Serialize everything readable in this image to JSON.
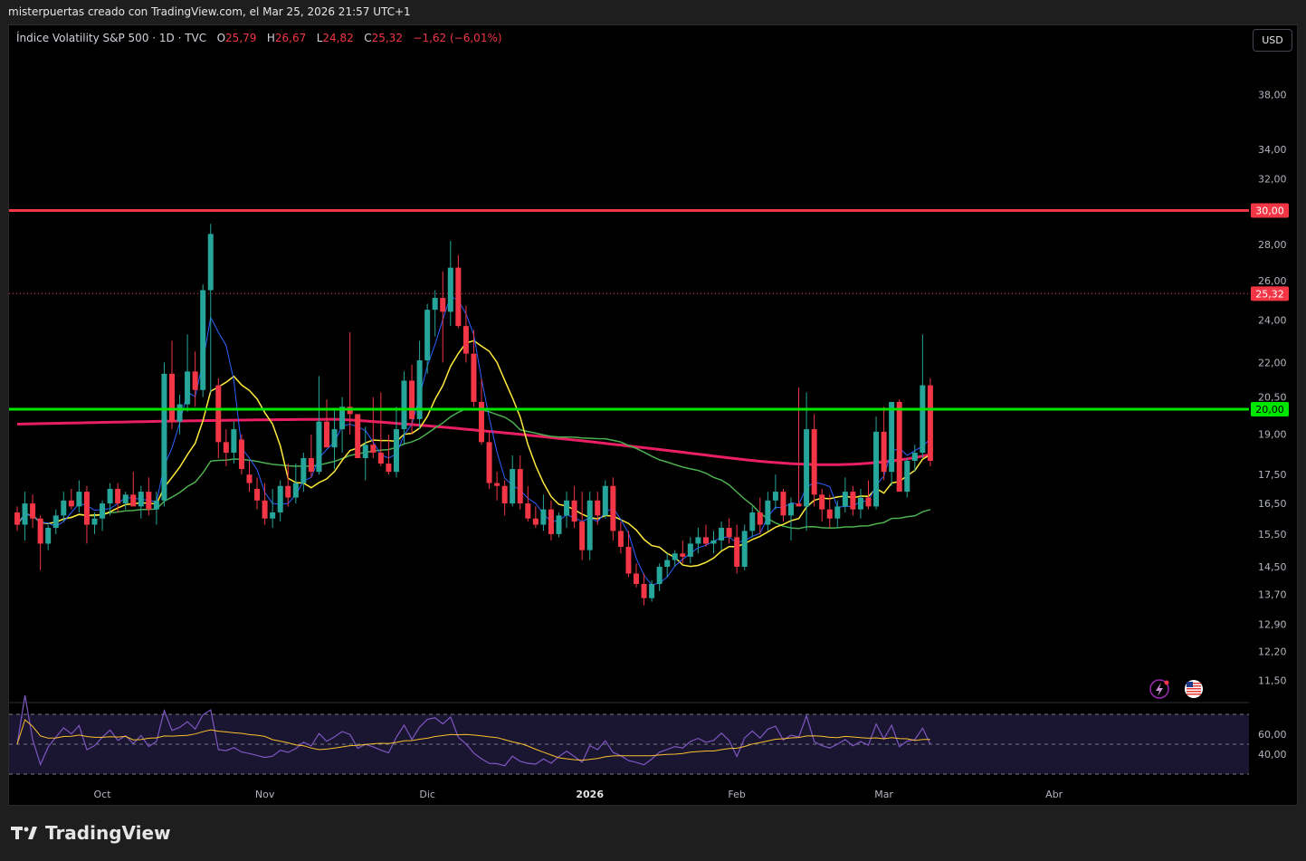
{
  "header": {
    "text": "misterpuertas creado con TradingView.com, el Mar 25, 2026 21:57 UTC+1"
  },
  "legend": {
    "symbol": "Índice Volatility S&P 500 · 1D · TVC",
    "open_label": "O",
    "open": "25,79",
    "high_label": "H",
    "high": "26,67",
    "low_label": "L",
    "low": "24,82",
    "close_label": "C",
    "close": "25,32",
    "change": "−1,62 (−6,01%)"
  },
  "currency_button": "USD",
  "brand": "TradingView",
  "colors": {
    "up": "#26a69a",
    "down": "#f23645",
    "resistance": "#f23645",
    "support": "#00e600",
    "ma_fast": "#2962ff",
    "ma_mid": "#ffeb3b",
    "ma_slow": "#4caf50",
    "ma_long": "#e91e63",
    "rsi": "#7e57c2"
  },
  "icons": {
    "lightning": "lightning-icon",
    "flag": "us-flag-icon"
  },
  "chart_data": {
    "type": "candlestick",
    "y_scale": "log",
    "y_ticks": [
      "38,00",
      "34,00",
      "32,00",
      "30,00",
      "28,00",
      "26,00",
      "24,00",
      "22,00",
      "20,50",
      "19,00",
      "17,50",
      "16,50",
      "15,50",
      "14,50",
      "13,70",
      "12,90",
      "12,20",
      "11,50"
    ],
    "x_ticks": [
      {
        "label": "Oct",
        "bold": false,
        "i": 11
      },
      {
        "label": "Nov",
        "bold": false,
        "i": 32
      },
      {
        "label": "Dic",
        "bold": false,
        "i": 53
      },
      {
        "label": "2026",
        "bold": true,
        "i": 74
      },
      {
        "label": "Feb",
        "bold": false,
        "i": 93
      },
      {
        "label": "Mar",
        "bold": false,
        "i": 112
      },
      {
        "label": "Abr",
        "bold": false,
        "i": 134
      }
    ],
    "horizontal_levels": [
      {
        "value": 30.0,
        "label": "30,00",
        "color": "#f23645"
      },
      {
        "value": 20.0,
        "label": "20,00",
        "color": "#00e600"
      }
    ],
    "last_price": {
      "value": 25.32,
      "label": "25,32"
    },
    "candles": [
      [
        16.2,
        16.4,
        15.6,
        15.8
      ],
      [
        15.8,
        16.9,
        15.3,
        16.5
      ],
      [
        16.5,
        16.8,
        15.7,
        16.0
      ],
      [
        16.0,
        16.1,
        14.4,
        15.2
      ],
      [
        15.2,
        15.8,
        15.0,
        15.7
      ],
      [
        15.7,
        16.3,
        15.5,
        16.1
      ],
      [
        16.1,
        16.9,
        15.9,
        16.6
      ],
      [
        16.6,
        17.0,
        16.3,
        16.4
      ],
      [
        16.4,
        17.3,
        16.2,
        16.9
      ],
      [
        16.9,
        17.1,
        15.2,
        15.8
      ],
      [
        15.8,
        16.2,
        15.5,
        16.0
      ],
      [
        16.0,
        16.6,
        15.6,
        16.5
      ],
      [
        16.5,
        17.2,
        16.1,
        17.0
      ],
      [
        17.0,
        17.2,
        16.2,
        16.5
      ],
      [
        16.5,
        16.9,
        16.3,
        16.8
      ],
      [
        16.8,
        17.6,
        16.5,
        16.4
      ],
      [
        16.4,
        17.1,
        16.0,
        16.9
      ],
      [
        16.9,
        17.4,
        16.1,
        16.3
      ],
      [
        16.3,
        16.9,
        15.8,
        16.6
      ],
      [
        16.6,
        22.0,
        16.4,
        21.5
      ],
      [
        21.5,
        23.0,
        19.2,
        19.5
      ],
      [
        19.5,
        20.6,
        19.0,
        20.2
      ],
      [
        20.2,
        23.3,
        19.9,
        21.6
      ],
      [
        21.6,
        22.5,
        20.1,
        20.8
      ],
      [
        20.8,
        25.8,
        20.5,
        25.5
      ],
      [
        25.5,
        29.2,
        20.7,
        28.6
      ],
      [
        21.0,
        21.3,
        18.1,
        18.7
      ],
      [
        18.7,
        19.2,
        17.8,
        18.3
      ],
      [
        18.3,
        19.5,
        17.9,
        19.2
      ],
      [
        18.8,
        19.0,
        17.5,
        17.7
      ],
      [
        17.5,
        18.0,
        16.9,
        17.2
      ],
      [
        17.0,
        17.4,
        16.3,
        16.6
      ],
      [
        16.6,
        17.2,
        15.8,
        16.0
      ],
      [
        16.0,
        17.0,
        15.7,
        16.2
      ],
      [
        16.2,
        17.3,
        15.9,
        17.1
      ],
      [
        17.1,
        17.9,
        16.4,
        16.7
      ],
      [
        16.7,
        17.9,
        16.5,
        17.2
      ],
      [
        17.2,
        18.3,
        16.9,
        18.1
      ],
      [
        18.1,
        19.0,
        17.4,
        17.6
      ],
      [
        17.6,
        21.4,
        17.5,
        19.5
      ],
      [
        19.5,
        20.4,
        18.6,
        18.5
      ],
      [
        18.5,
        20.0,
        17.7,
        19.2
      ],
      [
        19.2,
        20.5,
        18.3,
        20.1
      ],
      [
        20.1,
        23.4,
        19.0,
        19.8
      ],
      [
        19.8,
        19.8,
        18.5,
        18.1
      ],
      [
        18.1,
        19.3,
        17.3,
        18.6
      ],
      [
        18.6,
        20.5,
        18.1,
        18.3
      ],
      [
        18.3,
        20.7,
        17.8,
        17.9
      ],
      [
        17.9,
        19.0,
        17.5,
        17.6
      ],
      [
        17.6,
        20.1,
        17.4,
        19.2
      ],
      [
        19.2,
        21.6,
        18.6,
        21.2
      ],
      [
        21.2,
        21.9,
        19.0,
        19.6
      ],
      [
        19.6,
        23.0,
        19.2,
        22.1
      ],
      [
        22.1,
        24.8,
        21.5,
        24.5
      ],
      [
        24.5,
        25.5,
        23.2,
        25.1
      ],
      [
        25.1,
        26.5,
        22.0,
        24.4
      ],
      [
        24.4,
        28.2,
        23.7,
        26.7
      ],
      [
        26.7,
        27.4,
        23.6,
        23.7
      ],
      [
        23.7,
        24.7,
        22.0,
        22.4
      ],
      [
        22.4,
        23.5,
        20.1,
        20.3
      ],
      [
        20.3,
        21.3,
        18.6,
        18.7
      ],
      [
        18.7,
        19.1,
        17.0,
        17.2
      ],
      [
        17.2,
        17.6,
        16.6,
        17.1
      ],
      [
        17.1,
        17.3,
        16.1,
        16.5
      ],
      [
        16.5,
        18.2,
        16.4,
        17.7
      ],
      [
        17.7,
        18.2,
        16.3,
        16.5
      ],
      [
        16.5,
        17.1,
        15.9,
        16.0
      ],
      [
        16.0,
        16.4,
        15.7,
        15.8
      ],
      [
        15.8,
        16.8,
        15.6,
        16.3
      ],
      [
        16.3,
        16.6,
        15.3,
        15.5
      ],
      [
        15.5,
        16.2,
        15.4,
        16.1
      ],
      [
        16.1,
        16.9,
        15.7,
        16.6
      ],
      [
        16.6,
        17.1,
        15.7,
        15.9
      ],
      [
        15.9,
        16.9,
        14.7,
        15.0
      ],
      [
        15.0,
        16.9,
        14.7,
        16.6
      ],
      [
        16.6,
        16.9,
        15.8,
        16.1
      ],
      [
        16.1,
        17.3,
        16.0,
        17.1
      ],
      [
        17.1,
        17.4,
        15.3,
        15.6
      ],
      [
        15.6,
        15.9,
        14.9,
        15.1
      ],
      [
        15.1,
        15.6,
        14.2,
        14.3
      ],
      [
        14.3,
        14.6,
        13.9,
        14.0
      ],
      [
        14.0,
        14.3,
        13.4,
        13.6
      ],
      [
        13.6,
        14.1,
        13.5,
        14.0
      ],
      [
        14.0,
        14.6,
        13.8,
        14.5
      ],
      [
        14.5,
        14.9,
        14.2,
        14.7
      ],
      [
        14.7,
        15.0,
        14.5,
        14.9
      ],
      [
        14.9,
        15.3,
        14.6,
        14.8
      ],
      [
        14.8,
        15.4,
        14.6,
        15.2
      ],
      [
        15.2,
        15.7,
        14.9,
        15.4
      ],
      [
        15.4,
        15.8,
        15.1,
        15.2
      ],
      [
        15.2,
        15.6,
        14.9,
        15.3
      ],
      [
        15.3,
        15.9,
        15.0,
        15.7
      ],
      [
        15.7,
        16.0,
        15.2,
        15.4
      ],
      [
        15.4,
        15.8,
        14.3,
        14.5
      ],
      [
        14.5,
        15.8,
        14.4,
        15.6
      ],
      [
        15.6,
        16.4,
        15.4,
        16.2
      ],
      [
        16.2,
        16.7,
        15.5,
        15.8
      ],
      [
        15.8,
        16.9,
        15.6,
        16.6
      ],
      [
        16.6,
        17.5,
        16.3,
        16.9
      ],
      [
        16.9,
        17.0,
        15.9,
        16.1
      ],
      [
        16.1,
        16.7,
        15.3,
        16.5
      ],
      [
        16.5,
        20.9,
        16.4,
        16.4
      ],
      [
        16.4,
        20.7,
        15.6,
        19.2
      ],
      [
        19.2,
        19.8,
        16.4,
        16.8
      ],
      [
        16.8,
        17.0,
        15.9,
        16.3
      ],
      [
        16.3,
        16.8,
        15.7,
        16.0
      ],
      [
        16.0,
        16.6,
        15.7,
        16.4
      ],
      [
        16.4,
        17.4,
        16.2,
        16.9
      ],
      [
        16.9,
        17.1,
        16.1,
        16.3
      ],
      [
        16.3,
        17.0,
        16.0,
        16.7
      ],
      [
        16.7,
        17.3,
        16.3,
        16.4
      ],
      [
        16.4,
        19.7,
        16.3,
        19.1
      ],
      [
        19.1,
        20.1,
        17.3,
        17.6
      ],
      [
        17.6,
        20.2,
        17.1,
        20.3
      ],
      [
        20.3,
        20.4,
        17.0,
        16.9
      ],
      [
        16.9,
        18.1,
        16.7,
        18.0
      ],
      [
        18.0,
        18.6,
        17.6,
        18.3
      ],
      [
        18.3,
        23.3,
        18.1,
        21.0
      ],
      [
        21.0,
        21.3,
        17.8,
        18.0
      ]
    ],
    "rsi": {
      "ticks": [
        "60,00",
        "40,00"
      ],
      "upper": 70,
      "lower": 30,
      "mid": 50
    }
  }
}
